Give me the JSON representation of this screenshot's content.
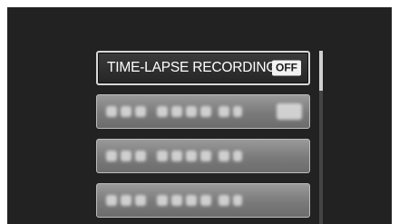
{
  "menu": {
    "selected_item": {
      "label": "TIME-LAPSE RECORDING",
      "value": "OFF"
    },
    "disabled_items": [
      {
        "label": ""
      },
      {
        "label": ""
      },
      {
        "label": ""
      }
    ]
  },
  "scrollbar": {
    "position_fraction": 0.0
  },
  "colors": {
    "screen_background": "#222222",
    "selected_border": "#d8d8d8",
    "dim_item": "#7a7a7a"
  }
}
